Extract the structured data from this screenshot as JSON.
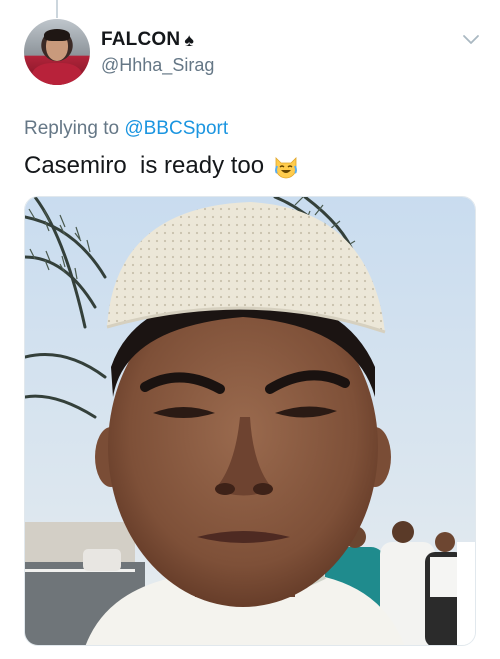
{
  "author": {
    "display_name": "FALCON",
    "name_glyph": "♠",
    "handle": "@Hhha_Sirag"
  },
  "reply": {
    "prefix": "Replying to",
    "mention": "@BBCSport"
  },
  "tweet": {
    "text": "Casemiro  is ready too",
    "emoji": "joy-cat"
  },
  "icons": {
    "menu": "chevron-down-icon",
    "name_badge": "spade-icon"
  },
  "colors": {
    "text": "#14171a",
    "secondary": "#657786",
    "link": "#1b95e0"
  }
}
